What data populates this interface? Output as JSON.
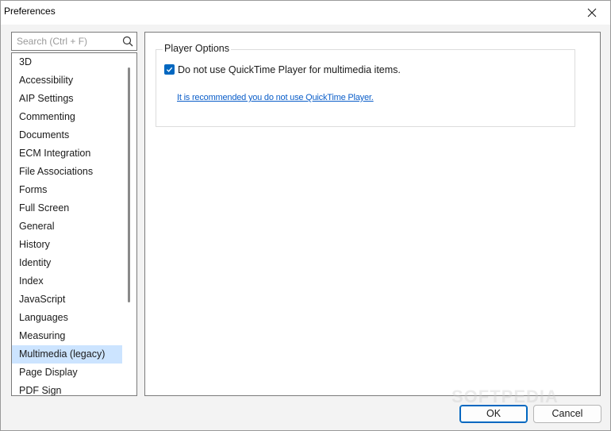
{
  "window": {
    "title": "Preferences"
  },
  "search": {
    "placeholder": "Search (Ctrl + F)"
  },
  "categories": [
    {
      "label": "3D"
    },
    {
      "label": "Accessibility"
    },
    {
      "label": "AIP Settings"
    },
    {
      "label": "Commenting"
    },
    {
      "label": "Documents"
    },
    {
      "label": "ECM Integration"
    },
    {
      "label": "File Associations"
    },
    {
      "label": "Forms"
    },
    {
      "label": "Full Screen"
    },
    {
      "label": "General"
    },
    {
      "label": "History"
    },
    {
      "label": "Identity"
    },
    {
      "label": "Index"
    },
    {
      "label": "JavaScript"
    },
    {
      "label": "Languages"
    },
    {
      "label": "Measuring"
    },
    {
      "label": "Multimedia (legacy)",
      "selected": true
    },
    {
      "label": "Page Display"
    },
    {
      "label": "PDF Sign"
    }
  ],
  "player_options": {
    "group_title": "Player Options",
    "checkbox_label": "Do not use QuickTime Player for multimedia items.",
    "checkbox_checked": true,
    "link_text": "It is recommended you do not use QuickTime Player."
  },
  "buttons": {
    "ok": "OK",
    "cancel": "Cancel"
  },
  "watermark": "SOFTPEDIA",
  "colors": {
    "accent": "#0067c0",
    "selection": "#cce4ff",
    "link": "#0b5ec9"
  }
}
